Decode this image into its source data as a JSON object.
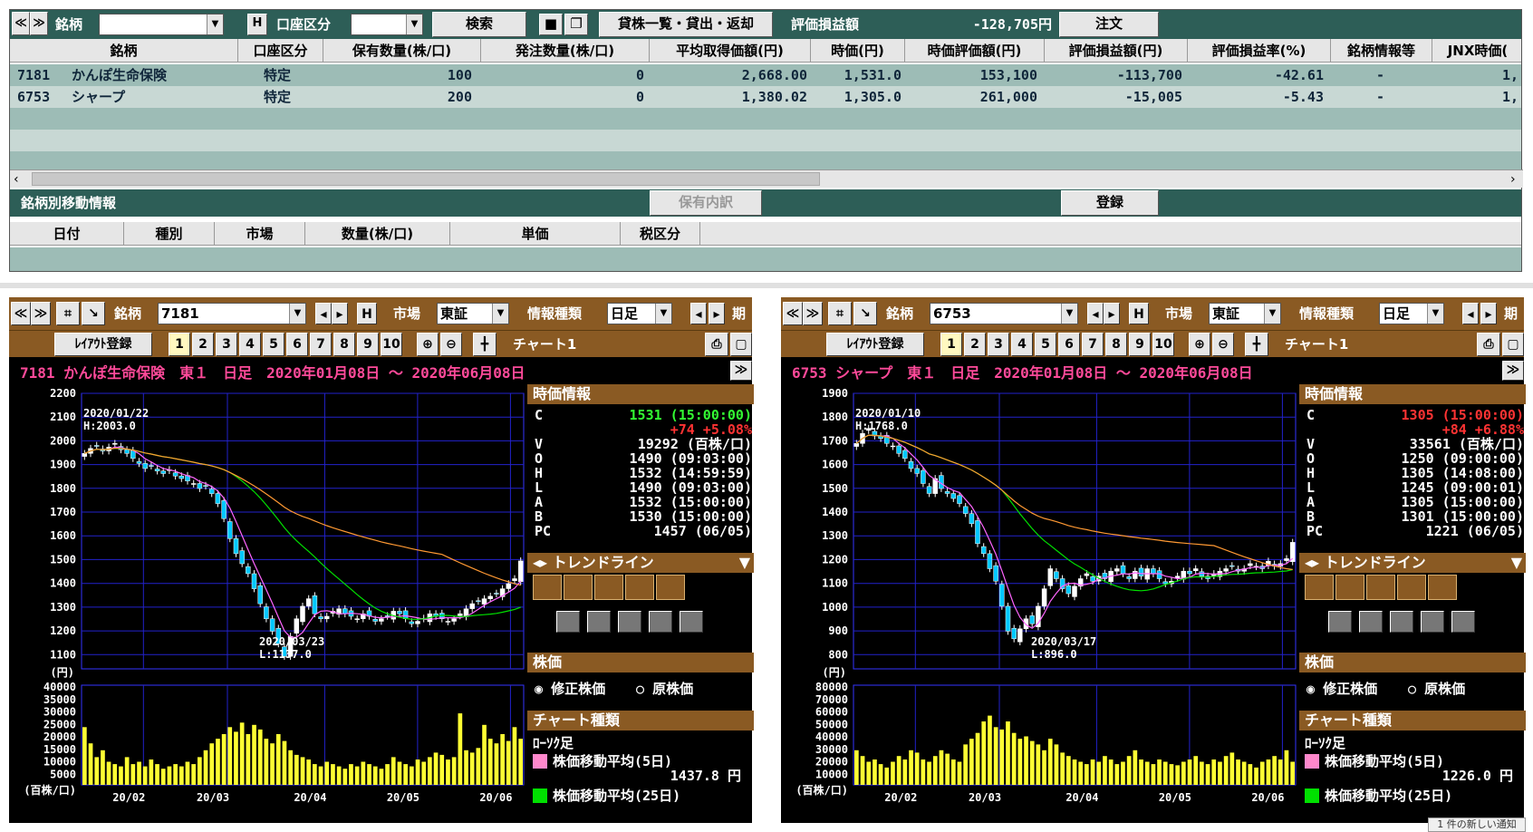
{
  "portfolio": {
    "toolbar": {
      "nav_left": "≪",
      "nav_right": "≫",
      "stock_label": "銘柄",
      "stock_value": "",
      "h_button": "H",
      "account_label": "口座区分",
      "account_value": "",
      "search_button": "検索",
      "save_icon": "save-icon",
      "copy_icon": "copy-icon",
      "lending_button": "貸株一覧・貸出・返却",
      "pnl_label": "評価損益額",
      "pnl_value": "-128,705円",
      "order_button": "注文"
    },
    "columns": [
      "銘柄",
      "口座区分",
      "保有数量(株/口)",
      "発注数量(株/口)",
      "平均取得価額(円)",
      "時価(円)",
      "時価評価額(円)",
      "評価損益額(円)",
      "評価損益率(%)",
      "銘柄情報等",
      "JNX時価("
    ],
    "rows": [
      {
        "code": "7181",
        "name": "かんぽ生命保険",
        "account": "特定",
        "holding": "100",
        "order": "0",
        "avg": "2,668.00",
        "price": "1,531.0",
        "value": "153,100",
        "pnl": "-113,700",
        "rate": "-42.61",
        "info": "-",
        "jnx": "1,"
      },
      {
        "code": "6753",
        "name": "シャープ",
        "account": "特定",
        "holding": "200",
        "order": "0",
        "avg": "1,380.02",
        "price": "1,305.0",
        "value": "261,000",
        "pnl": "-15,005",
        "rate": "-5.43",
        "info": "-",
        "jnx": "1,"
      }
    ],
    "movement": {
      "title": "銘柄別移動情報",
      "breakdown_button": "保有内訳",
      "register_button": "登録",
      "columns": [
        "日付",
        "種別",
        "市場",
        "数量(株/口)",
        "単価",
        "税区分"
      ]
    }
  },
  "charts": [
    {
      "stock_label": "銘柄",
      "code": "7181",
      "market_label": "市場",
      "market": "東証",
      "info_label": "情報種類",
      "info": "日足",
      "period_label": "期",
      "layout_button": "ﾚｲｱｳﾄ登録",
      "pages": [
        "1",
        "2",
        "3",
        "4",
        "5",
        "6",
        "7",
        "8",
        "9",
        "10"
      ],
      "chart_label": "チャート1",
      "title": "7181 かんぽ生命保険　東１　日足　2020年01月08日 ～ 2020年06月08日",
      "high_note": [
        "2020/01/22",
        "H:2003.0"
      ],
      "low_note": [
        "2020/03/23",
        "L:1137.0"
      ],
      "quote_header": "時価情報",
      "quote": {
        "C": "1531 (15:00:00)",
        "chg": "+74 +5.08%",
        "V": "19292 (百株/口)",
        "O": "1490 (09:03:00)",
        "H": "1532 (14:59:59)",
        "L": "1490 (09:03:00)",
        "A": "1532 (15:00:00)",
        "B": "1530 (15:00:00)",
        "PC": "1457 (06/05)"
      },
      "trend_label": "トレンドライン",
      "price_header": "株価",
      "adj_label": "修正株価",
      "raw_label": "原株価",
      "type_header": "チャート種類",
      "candle_label": "ﾛｰｿｸ足",
      "ma5_label": "株価移動平均(5日)",
      "ma5_value": "1437.8 円",
      "ma25_label": "株価移動平均(25日)",
      "yen_unit": "(円)",
      "vol_unit": "(百株/口)",
      "chart_data": {
        "type": "candlestick",
        "ylim": [
          1100,
          2200
        ],
        "yticks": [
          "2200",
          "2100",
          "2000",
          "1900",
          "1800",
          "1700",
          "1600",
          "1500",
          "1400",
          "1300",
          "1200",
          "1100"
        ],
        "vticks": [
          "40000",
          "35000",
          "30000",
          "25000",
          "20000",
          "15000",
          "10000",
          "5000"
        ],
        "xlabels": [
          "20/02",
          "20/03",
          "20/04",
          "20/05",
          "20/06"
        ],
        "close": [
          1960,
          1980,
          1990,
          1970,
          1985,
          2000,
          1975,
          1960,
          1940,
          1920,
          1900,
          1910,
          1890,
          1880,
          1895,
          1870,
          1860,
          1850,
          1840,
          1820,
          1830,
          1800,
          1760,
          1700,
          1620,
          1560,
          1520,
          1480,
          1420,
          1360,
          1300,
          1250,
          1200,
          1150,
          1230,
          1300,
          1350,
          1380,
          1320,
          1300,
          1310,
          1330,
          1340,
          1320,
          1310,
          1300,
          1320,
          1310,
          1290,
          1300,
          1310,
          1330,
          1320,
          1300,
          1280,
          1290,
          1300,
          1320,
          1310,
          1300,
          1290,
          1300,
          1320,
          1340,
          1360,
          1370,
          1380,
          1390,
          1400,
          1420,
          1440,
          1460,
          1531
        ],
        "volume": [
          25000,
          18000,
          12000,
          15000,
          10000,
          9000,
          8000,
          12000,
          9000,
          10000,
          8000,
          11000,
          9000,
          7000,
          8000,
          9000,
          8000,
          10000,
          9000,
          12000,
          15000,
          18000,
          20000,
          22000,
          25000,
          23000,
          27000,
          22000,
          26000,
          24000,
          20000,
          18000,
          22000,
          19000,
          15000,
          13000,
          12000,
          11000,
          9000,
          8000,
          10000,
          9000,
          8000,
          7000,
          9000,
          8000,
          10000,
          9000,
          8000,
          7000,
          9000,
          12000,
          10000,
          9000,
          8000,
          11000,
          10000,
          12000,
          14000,
          13000,
          11000,
          12000,
          31000,
          15000,
          14000,
          16000,
          26000,
          20000,
          18000,
          22000,
          19000,
          25000,
          20000
        ],
        "ma_colors": {
          "ma5": "#ff66ff",
          "ma25": "#00e000",
          "ma75": "#ff9933"
        }
      }
    },
    {
      "stock_label": "銘柄",
      "code": "6753",
      "market_label": "市場",
      "market": "東証",
      "info_label": "情報種類",
      "info": "日足",
      "period_label": "期",
      "layout_button": "ﾚｲｱｳﾄ登録",
      "pages": [
        "1",
        "2",
        "3",
        "4",
        "5",
        "6",
        "7",
        "8",
        "9",
        "10"
      ],
      "chart_label": "チャート1",
      "title": "6753 シャープ　東１　日足　2020年01月08日 ～ 2020年06月08日",
      "high_note": [
        "2020/01/10",
        "H:1768.0"
      ],
      "low_note": [
        "2020/03/17",
        "L:896.0"
      ],
      "quote_header": "時価情報",
      "quote": {
        "C": "1305 (15:00:00)",
        "chg": "+84 +6.88%",
        "V": "33561 (百株/口)",
        "O": "1250 (09:00:00)",
        "H": "1305 (14:08:00)",
        "L": "1245 (09:00:01)",
        "A": "1305 (15:00:00)",
        "B": "1301 (15:00:00)",
        "PC": "1221 (06/05)"
      },
      "trend_label": "トレンドライン",
      "price_header": "株価",
      "adj_label": "修正株価",
      "raw_label": "原株価",
      "type_header": "チャート種類",
      "candle_label": "ﾛｰｿｸ足",
      "ma5_label": "株価移動平均(5日)",
      "ma5_value": "1226.0 円",
      "ma25_label": "株価移動平均(25日)",
      "yen_unit": "(円)",
      "vol_unit": "(百株/口)",
      "chart_data": {
        "type": "candlestick",
        "ylim": [
          800,
          1900
        ],
        "yticks": [
          "1900",
          "1800",
          "1700",
          "1600",
          "1500",
          "1400",
          "1300",
          "1200",
          "1100",
          "1000",
          "900",
          "800"
        ],
        "vticks": [
          "80000",
          "70000",
          "60000",
          "50000",
          "40000",
          "30000",
          "20000",
          "10000"
        ],
        "xlabels": [
          "20/02",
          "20/03",
          "20/04",
          "20/05",
          "20/06"
        ],
        "close": [
          1700,
          1740,
          1760,
          1730,
          1720,
          1700,
          1690,
          1660,
          1640,
          1600,
          1580,
          1540,
          1500,
          1560,
          1520,
          1500,
          1480,
          1460,
          1420,
          1380,
          1300,
          1260,
          1200,
          1150,
          1050,
          950,
          920,
          960,
          1000,
          980,
          1050,
          1120,
          1200,
          1160,
          1120,
          1100,
          1130,
          1160,
          1180,
          1150,
          1170,
          1160,
          1190,
          1200,
          1180,
          1160,
          1190,
          1170,
          1200,
          1180,
          1160,
          1140,
          1150,
          1170,
          1190,
          1180,
          1200,
          1170,
          1160,
          1180,
          1190,
          1200,
          1210,
          1190,
          1200,
          1220,
          1210,
          1200,
          1230,
          1210,
          1220,
          1240,
          1305
        ],
        "volume": [
          30000,
          25000,
          20000,
          22000,
          18000,
          15000,
          20000,
          25000,
          22000,
          30000,
          28000,
          22000,
          20000,
          25000,
          30000,
          27000,
          22000,
          20000,
          35000,
          40000,
          45000,
          55000,
          60000,
          50000,
          48000,
          55000,
          45000,
          40000,
          42000,
          38000,
          35000,
          30000,
          40000,
          35000,
          28000,
          25000,
          22000,
          20000,
          18000,
          22000,
          20000,
          25000,
          22000,
          18000,
          20000,
          25000,
          30000,
          22000,
          20000,
          18000,
          22000,
          20000,
          18000,
          17000,
          20000,
          22000,
          25000,
          20000,
          18000,
          22000,
          20000,
          25000,
          28000,
          22000,
          20000,
          18000,
          15000,
          20000,
          22000,
          25000,
          22000,
          30000,
          20000
        ]
      }
    }
  ],
  "notification": "1 件の新しい通知"
}
